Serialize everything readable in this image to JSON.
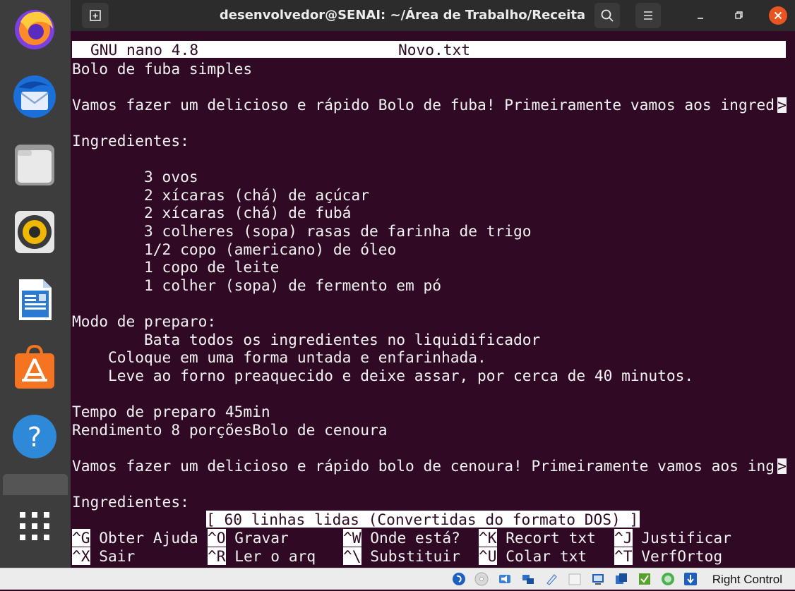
{
  "dock": {
    "items": [
      {
        "name": "firefox"
      },
      {
        "name": "thunderbird"
      },
      {
        "name": "files"
      },
      {
        "name": "rhythmbox"
      },
      {
        "name": "libreoffice-writer"
      },
      {
        "name": "software-center"
      },
      {
        "name": "help"
      },
      {
        "name": "terminal"
      },
      {
        "name": "show-applications"
      }
    ]
  },
  "titlebar": {
    "title": "desenvolvedor@SENAI: ~/Área de Trabalho/Receita"
  },
  "nano": {
    "version": "GNU nano 4.8",
    "filename": "Novo.txt",
    "lines": [
      "Bolo de fuba simples",
      "",
      "Vamos fazer um delicioso e rápido Bolo de fuba! Primeiramente vamos aos ingred",
      "",
      "Ingredientes:",
      "",
      "        3 ovos",
      "        2 xícaras (chá) de açúcar",
      "        2 xícaras (chá) de fubá",
      "        3 colheres (sopa) rasas de farinha de trigo",
      "        1/2 copo (americano) de óleo",
      "        1 copo de leite",
      "        1 colher (sopa) de fermento em pó",
      "",
      "Modo de preparo:",
      "        Bata todos os ingredientes no liquidificador",
      "    Coloque em uma forma untada e enfarinhada.",
      "    Leve ao forno preaquecido e deixe assar, por cerca de 40 minutos.",
      "",
      "Tempo de preparo 45min",
      "Rendimento 8 porçõesBolo de cenoura",
      "",
      "Vamos fazer um delicioso e rápido bolo de cenoura! Primeiramente vamos aos ing",
      "",
      "Ingredientes:"
    ],
    "overflow_marker": ">",
    "status": "[ 60 linhas lidas (Convertidas do formato DOS) ]",
    "shortcuts": {
      "row1": [
        {
          "key": "^G",
          "label": "Obter Ajuda"
        },
        {
          "key": "^O",
          "label": "Gravar"
        },
        {
          "key": "^W",
          "label": "Onde está?"
        },
        {
          "key": "^K",
          "label": "Recort txt"
        },
        {
          "key": "^J",
          "label": "Justificar"
        }
      ],
      "row2": [
        {
          "key": "^X",
          "label": "Sair"
        },
        {
          "key": "^R",
          "label": "Ler o arq"
        },
        {
          "key": "^\\",
          "label": "Substituir"
        },
        {
          "key": "^U",
          "label": "Colar txt"
        },
        {
          "key": "^T",
          "label": "VerfOrtog"
        }
      ]
    }
  },
  "vbox": {
    "host_key": "Right Control"
  },
  "colors": {
    "terminal_bg": "#300a24",
    "terminal_fg": "#f2f2f2",
    "titlebar_bg": "#2c2c2c",
    "close_button": "#e95420",
    "dock_bg": "#3d3d3d"
  }
}
